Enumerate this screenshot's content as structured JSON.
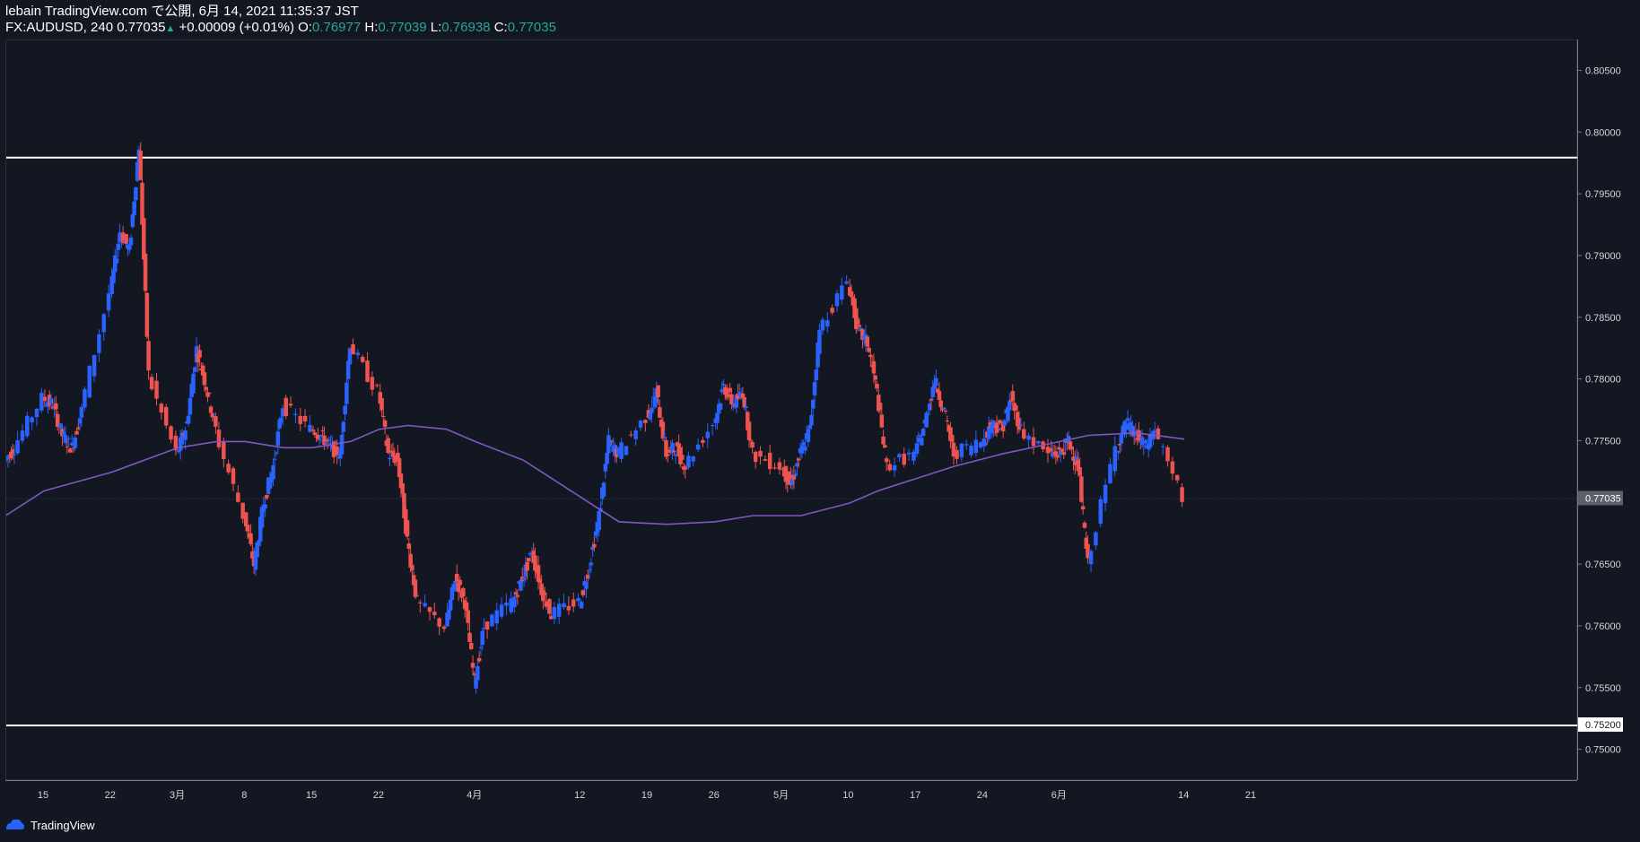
{
  "header": {
    "line1": "lebain TradingView.com で公開, 6月 14, 2021 11:35:37 JST",
    "symbol": "FX:AUDUSD, 240",
    "last": "0.77035",
    "change": "+0.00009 (+0.01%)",
    "o_label": "O:",
    "o": "0.76977",
    "h_label": "H:",
    "h": "0.77039",
    "l_label": "L:",
    "l": "0.76938",
    "c_label": "C:",
    "c": "0.77035"
  },
  "footer": {
    "brand": "TradingView"
  },
  "colors": {
    "background": "#131722",
    "up": "#2962ff",
    "down": "#ef5350",
    "ma": "#7e57c2",
    "hline": "#ffffff",
    "ohlc_value": "#26a69a"
  },
  "chart_data": {
    "type": "line",
    "instrument": "FX:AUDUSD",
    "interval": "240",
    "ylim": [
      0.7475,
      0.8075
    ],
    "y_ticks": [
      "0.80500",
      "0.80000",
      "0.79500",
      "0.79000",
      "0.78500",
      "0.78000",
      "0.77500",
      "0.77035",
      "0.76500",
      "0.76000",
      "0.75500",
      "0.75200",
      "0.75000"
    ],
    "y_tick_values": [
      0.805,
      0.8,
      0.795,
      0.79,
      0.785,
      0.78,
      0.775,
      0.77035,
      0.765,
      0.76,
      0.755,
      0.752,
      0.75
    ],
    "x_ticks": [
      {
        "label": "15",
        "date": "2021-02-15"
      },
      {
        "label": "22",
        "date": "2021-02-22"
      },
      {
        "label": "3月",
        "date": "2021-03-01"
      },
      {
        "label": "8",
        "date": "2021-03-08"
      },
      {
        "label": "15",
        "date": "2021-03-15"
      },
      {
        "label": "22",
        "date": "2021-03-22"
      },
      {
        "label": "4月",
        "date": "2021-04-01"
      },
      {
        "label": "12",
        "date": "2021-04-12"
      },
      {
        "label": "19",
        "date": "2021-04-19"
      },
      {
        "label": "26",
        "date": "2021-04-26"
      },
      {
        "label": "5月",
        "date": "2021-05-03"
      },
      {
        "label": "10",
        "date": "2021-05-10"
      },
      {
        "label": "17",
        "date": "2021-05-17"
      },
      {
        "label": "24",
        "date": "2021-05-24"
      },
      {
        "label": "6月",
        "date": "2021-06-01"
      },
      {
        "label": "14",
        "date": "2021-06-14"
      },
      {
        "label": "21",
        "date": "2021-06-21"
      }
    ],
    "horizontal_lines": [
      {
        "price": 0.798,
        "label": "0.79800"
      },
      {
        "price": 0.752,
        "label": "0.75200"
      }
    ],
    "last_price": {
      "price": 0.77035,
      "label": "0.77035"
    },
    "series": [
      {
        "kind": "candlestick_close",
        "x": [
          "2021-02-11",
          "2021-02-12",
          "2021-02-15",
          "2021-02-16",
          "2021-02-17",
          "2021-02-18",
          "2021-02-19",
          "2021-02-22",
          "2021-02-23",
          "2021-02-24",
          "2021-02-25",
          "2021-02-26",
          "2021-03-01",
          "2021-03-02",
          "2021-03-03",
          "2021-03-04",
          "2021-03-05",
          "2021-03-08",
          "2021-03-09",
          "2021-03-10",
          "2021-03-11",
          "2021-03-12",
          "2021-03-15",
          "2021-03-16",
          "2021-03-17",
          "2021-03-18",
          "2021-03-19",
          "2021-03-22",
          "2021-03-23",
          "2021-03-24",
          "2021-03-25",
          "2021-03-26",
          "2021-03-29",
          "2021-03-30",
          "2021-03-31",
          "2021-04-01",
          "2021-04-02",
          "2021-04-05",
          "2021-04-06",
          "2021-04-07",
          "2021-04-08",
          "2021-04-09",
          "2021-04-12",
          "2021-04-13",
          "2021-04-14",
          "2021-04-15",
          "2021-04-16",
          "2021-04-19",
          "2021-04-20",
          "2021-04-21",
          "2021-04-22",
          "2021-04-23",
          "2021-04-26",
          "2021-04-27",
          "2021-04-28",
          "2021-04-29",
          "2021-04-30",
          "2021-05-03",
          "2021-05-04",
          "2021-05-05",
          "2021-05-06",
          "2021-05-07",
          "2021-05-10",
          "2021-05-11",
          "2021-05-12",
          "2021-05-13",
          "2021-05-14",
          "2021-05-17",
          "2021-05-18",
          "2021-05-19",
          "2021-05-20",
          "2021-05-21",
          "2021-05-24",
          "2021-05-25",
          "2021-05-26",
          "2021-05-27",
          "2021-05-28",
          "2021-05-31",
          "2021-06-01",
          "2021-06-02",
          "2021-06-03",
          "2021-06-04",
          "2021-06-07",
          "2021-06-08",
          "2021-06-09",
          "2021-06-10",
          "2021-06-11",
          "2021-06-14"
        ],
        "values": [
          0.7735,
          0.7745,
          0.7785,
          0.778,
          0.7755,
          0.7745,
          0.7775,
          0.787,
          0.792,
          0.7905,
          0.799,
          0.7805,
          0.774,
          0.7765,
          0.7825,
          0.7795,
          0.776,
          0.769,
          0.765,
          0.77,
          0.773,
          0.778,
          0.776,
          0.7755,
          0.7745,
          0.774,
          0.783,
          0.779,
          0.774,
          0.7735,
          0.767,
          0.762,
          0.76,
          0.764,
          0.762,
          0.7555,
          0.76,
          0.762,
          0.764,
          0.766,
          0.763,
          0.761,
          0.762,
          0.765,
          0.769,
          0.775,
          0.774,
          0.777,
          0.779,
          0.774,
          0.7745,
          0.773,
          0.7765,
          0.7795,
          0.778,
          0.779,
          0.774,
          0.773,
          0.7715,
          0.774,
          0.776,
          0.784,
          0.788,
          0.784,
          0.783,
          0.779,
          0.773,
          0.774,
          0.7765,
          0.78,
          0.7775,
          0.774,
          0.775,
          0.7765,
          0.776,
          0.7785,
          0.776,
          0.774,
          0.774,
          0.775,
          0.773,
          0.765,
          0.7745,
          0.7765,
          0.7755,
          0.7745,
          0.776,
          0.77035
        ]
      },
      {
        "kind": "moving_average",
        "x": [
          "2021-02-11",
          "2021-02-15",
          "2021-02-22",
          "2021-03-01",
          "2021-03-05",
          "2021-03-08",
          "2021-03-12",
          "2021-03-15",
          "2021-03-19",
          "2021-03-22",
          "2021-03-25",
          "2021-03-29",
          "2021-04-01",
          "2021-04-06",
          "2021-04-09",
          "2021-04-13",
          "2021-04-16",
          "2021-04-21",
          "2021-04-26",
          "2021-04-30",
          "2021-05-05",
          "2021-05-10",
          "2021-05-13",
          "2021-05-17",
          "2021-05-21",
          "2021-05-26",
          "2021-06-01",
          "2021-06-04",
          "2021-06-09",
          "2021-06-14"
        ],
        "values": [
          0.769,
          0.771,
          0.7725,
          0.7745,
          0.775,
          0.775,
          0.7745,
          0.7745,
          0.775,
          0.776,
          0.7763,
          0.776,
          0.775,
          0.7735,
          0.772,
          0.77,
          0.7685,
          0.7683,
          0.7685,
          0.769,
          0.769,
          0.77,
          0.771,
          0.772,
          0.773,
          0.774,
          0.775,
          0.7755,
          0.7757,
          0.7752
        ]
      }
    ]
  }
}
